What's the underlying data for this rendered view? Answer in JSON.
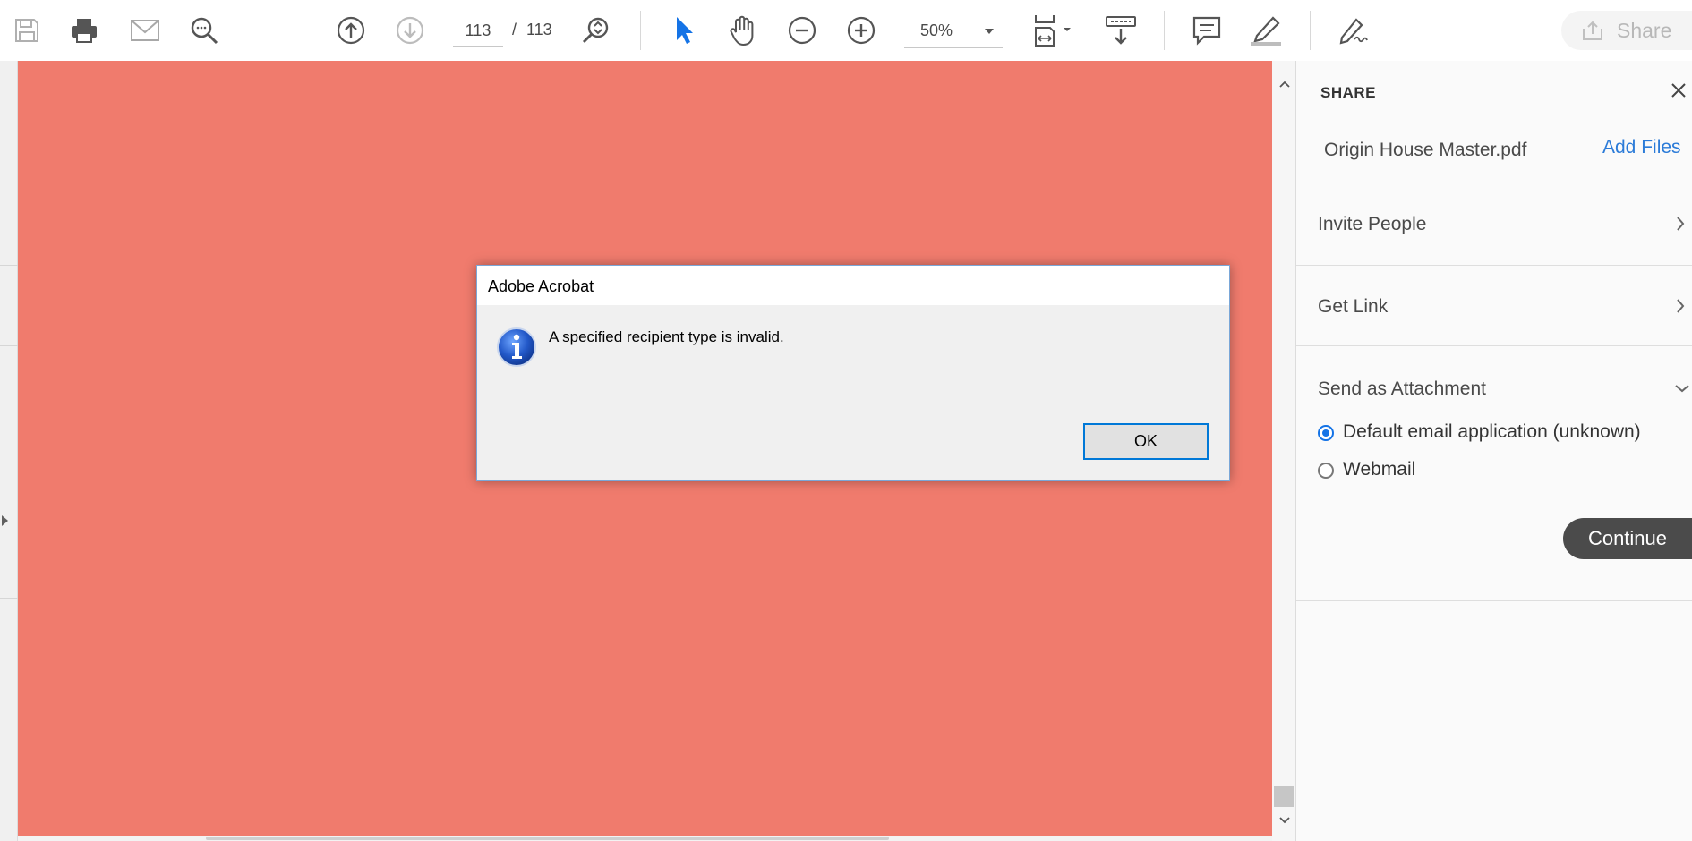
{
  "toolbar": {
    "page_current": "113",
    "page_separator": "/",
    "page_total": "113",
    "zoom": "50%",
    "share_label": "Share",
    "icons": [
      "save-icon",
      "print-icon",
      "email-icon",
      "search-icon",
      "page-up-icon",
      "page-down-icon",
      "find-zoom-icon",
      "select-cursor-icon",
      "hand-tool-icon",
      "zoom-out-icon",
      "zoom-in-icon",
      "fit-page-icon",
      "scroll-mode-icon",
      "comment-icon",
      "highlight-icon",
      "sign-icon",
      "share-icon"
    ]
  },
  "panel": {
    "title": "SHARE",
    "file_name": "Origin House Master.pdf",
    "add_files": "Add Files",
    "invite_people": "Invite People",
    "get_link": "Get Link",
    "send_attachment": "Send as Attachment",
    "options": [
      {
        "label": "Default email application (unknown)",
        "selected": true
      },
      {
        "label": "Webmail",
        "selected": false
      }
    ],
    "continue": "Continue"
  },
  "dialog": {
    "title": "Adobe Acrobat",
    "message": "A specified recipient type is invalid.",
    "ok": "OK"
  },
  "colors": {
    "page_fill": "#f07b6d",
    "accent_blue": "#1473e6",
    "link_blue": "#2b7bd8",
    "continue_bg": "#4b4b4b"
  }
}
